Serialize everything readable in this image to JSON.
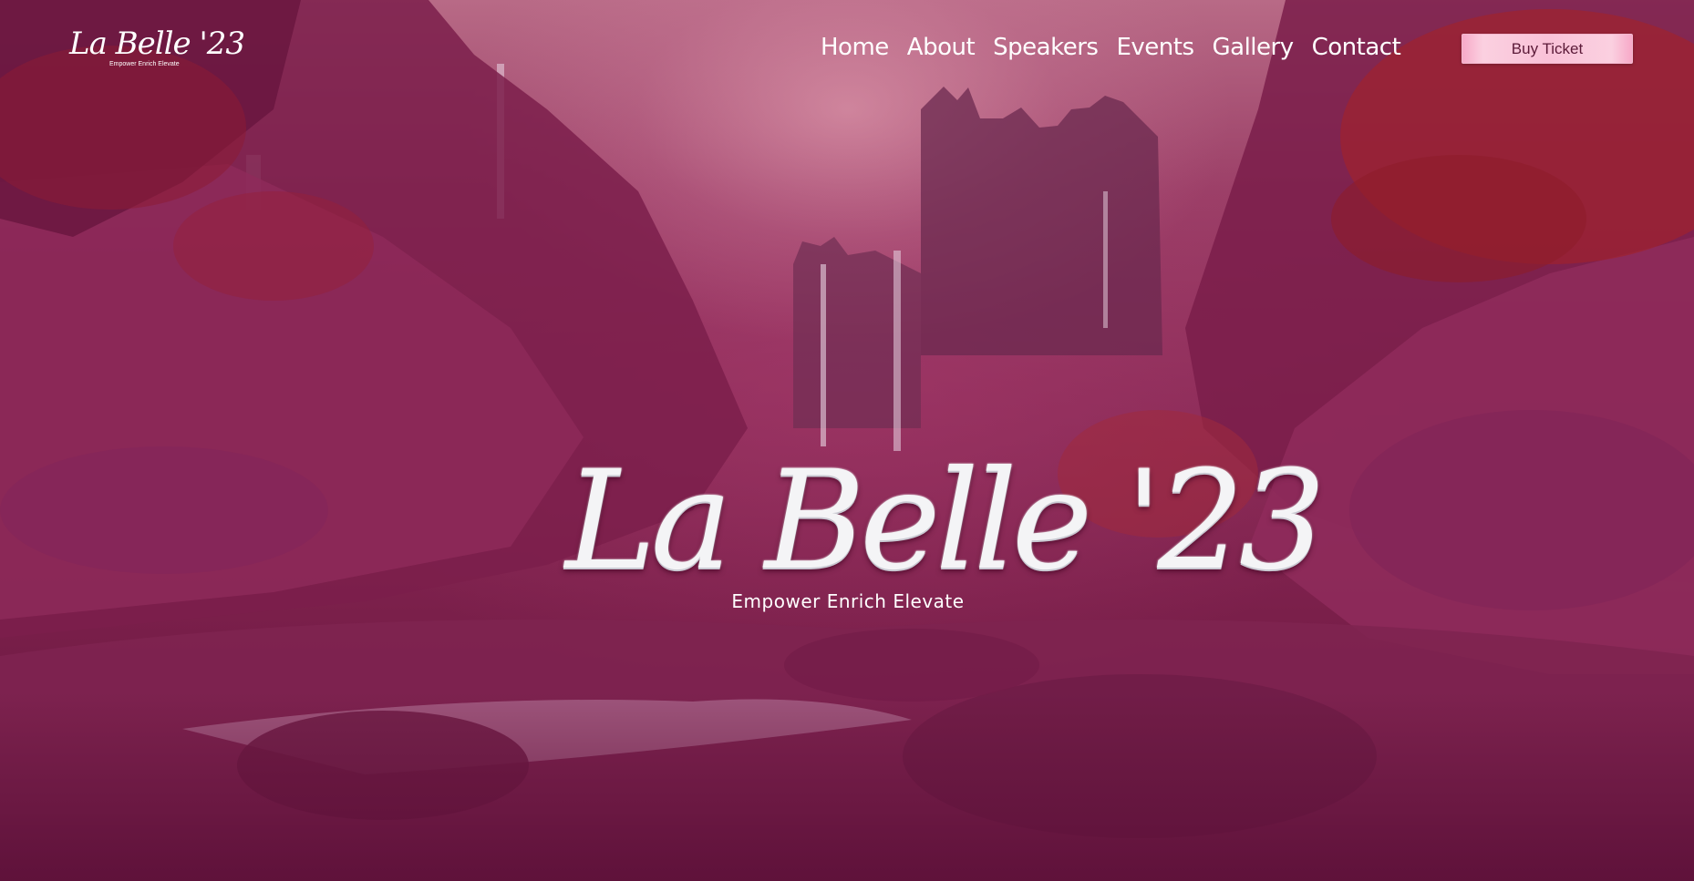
{
  "header": {
    "logo": {
      "word": "La Belle '23",
      "tagline": "Empower Enrich Elevate"
    },
    "nav": [
      {
        "label": "Home"
      },
      {
        "label": "About"
      },
      {
        "label": "Speakers"
      },
      {
        "label": "Events"
      },
      {
        "label": "Gallery"
      },
      {
        "label": "Contact"
      }
    ],
    "cta_label": "Buy Ticket"
  },
  "hero": {
    "title": "La Belle '23",
    "subtitle": "Empower Enrich Elevate",
    "background": "fantasy pink canyon with waterfalls and river"
  },
  "colors": {
    "accent": "#f9c2d8",
    "text": "#ffffff",
    "background": "#8a2b57"
  }
}
